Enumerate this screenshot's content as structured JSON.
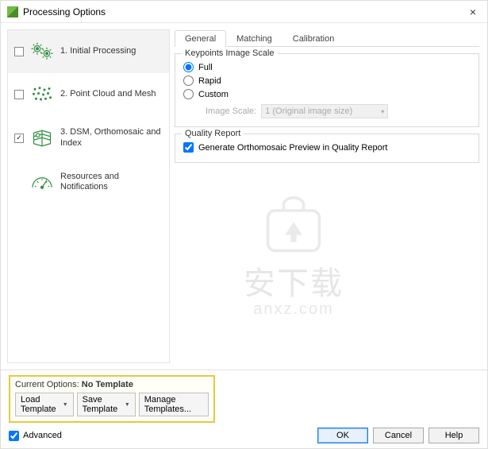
{
  "window": {
    "title": "Processing Options",
    "close": "×"
  },
  "sidebar": {
    "items": [
      {
        "label": "1. Initial Processing",
        "checked": false,
        "selected": true
      },
      {
        "label": "2. Point Cloud and Mesh",
        "checked": false,
        "selected": false
      },
      {
        "label": "3. DSM, Orthomosaic and Index",
        "checked": true,
        "selected": false
      },
      {
        "label": "Resources and Notifications",
        "checked": null,
        "selected": false
      }
    ]
  },
  "tabs": {
    "items": [
      "General",
      "Matching",
      "Calibration"
    ],
    "active": 0
  },
  "keypoints": {
    "legend": "Keypoints Image Scale",
    "options": [
      "Full",
      "Rapid",
      "Custom"
    ],
    "selected": "Full",
    "scale_label": "Image Scale:",
    "scale_value": "1 (Original image size)"
  },
  "quality_report": {
    "legend": "Quality Report",
    "checkbox_label": "Generate Orthomosaic Preview in Quality Report",
    "checked": true
  },
  "templates": {
    "current_label": "Current Options:",
    "current_value": "No Template",
    "load": "Load Template",
    "save": "Save Template",
    "manage": "Manage Templates..."
  },
  "advanced": {
    "label": "Advanced",
    "checked": true
  },
  "buttons": {
    "ok": "OK",
    "cancel": "Cancel",
    "help": "Help"
  },
  "watermark": {
    "line1": "安下载",
    "line2": "anxz.com"
  }
}
